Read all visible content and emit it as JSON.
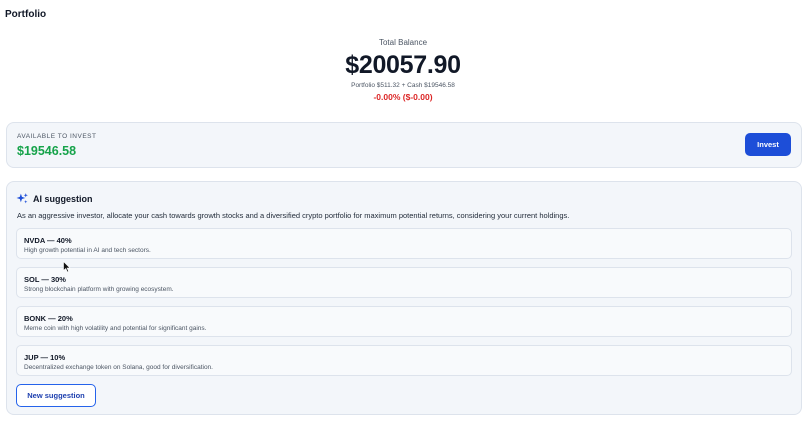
{
  "page": {
    "title": "Portfolio"
  },
  "balance": {
    "label": "Total Balance",
    "amount": "$20057.90",
    "breakdown": "Portfolio $511.32 + Cash $19546.58",
    "change": "-0.00% ($-0.00)",
    "change_color": "#dc2626"
  },
  "invest": {
    "label": "AVAILABLE TO INVEST",
    "amount": "$19546.58",
    "amount_color": "#16a34a",
    "button_label": "Invest",
    "button_color": "#1d4ed8"
  },
  "ai": {
    "icon": "sparkle-icon",
    "title": "AI suggestion",
    "description": "As an aggressive investor, allocate your cash towards growth stocks and a diversified crypto portfolio for maximum potential returns, considering your current holdings.",
    "suggestions": [
      {
        "title": "NVDA — 40%",
        "description": "High growth potential in AI and tech sectors."
      },
      {
        "title": "SOL — 30%",
        "description": "Strong blockchain platform with growing ecosystem."
      },
      {
        "title": "BONK — 20%",
        "description": "Meme coin with high volatility and potential for significant gains."
      },
      {
        "title": "JUP — 10%",
        "description": "Decentralized exchange token on Solana, good for diversification."
      }
    ],
    "new_button_label": "New suggestion"
  }
}
